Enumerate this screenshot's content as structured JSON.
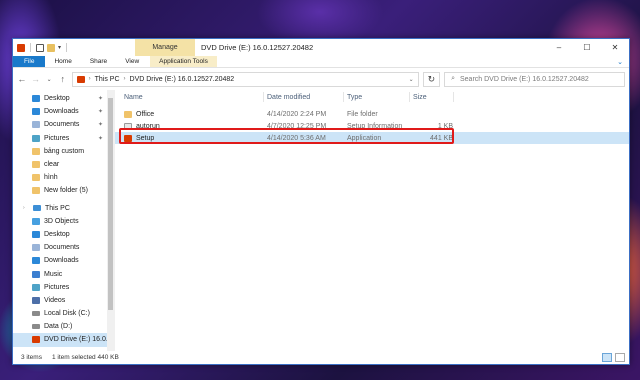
{
  "window": {
    "title": "DVD Drive (E:) 16.0.12527.20482",
    "manage_tab": "Manage",
    "controls": [
      "–",
      "☐",
      "✕"
    ]
  },
  "ribbon": {
    "tabs": [
      "File",
      "Home",
      "Share",
      "View",
      "Application Tools"
    ]
  },
  "address": {
    "crumbs": [
      "This PC",
      "DVD Drive (E:) 16.0.12527.20482"
    ],
    "search_placeholder": "Search DVD Drive (E:) 16.0.12527.20482"
  },
  "nav": {
    "quick_access": [
      {
        "label": "Desktop",
        "icon": "desktop-icon",
        "pinned": true
      },
      {
        "label": "Downloads",
        "icon": "downloads-icon",
        "pinned": true
      },
      {
        "label": "Documents",
        "icon": "documents-icon",
        "pinned": true
      },
      {
        "label": "Pictures",
        "icon": "pictures-icon",
        "pinned": true
      },
      {
        "label": "bảng custom",
        "icon": "folder-icon",
        "pinned": false
      },
      {
        "label": "clear",
        "icon": "folder-icon",
        "pinned": false
      },
      {
        "label": "hình",
        "icon": "folder-icon",
        "pinned": false
      },
      {
        "label": "New folder (5)",
        "icon": "folder-icon",
        "pinned": false
      }
    ],
    "this_pc_label": "This PC",
    "this_pc": [
      {
        "label": "3D Objects",
        "icon": "3d-objects-icon"
      },
      {
        "label": "Desktop",
        "icon": "desktop-icon"
      },
      {
        "label": "Documents",
        "icon": "documents-icon"
      },
      {
        "label": "Downloads",
        "icon": "downloads-icon"
      },
      {
        "label": "Music",
        "icon": "music-icon"
      },
      {
        "label": "Pictures",
        "icon": "pictures-icon"
      },
      {
        "label": "Videos",
        "icon": "videos-icon"
      },
      {
        "label": "Local Disk (C:)",
        "icon": "disk-icon"
      },
      {
        "label": "Data (D:)",
        "icon": "disk-icon"
      },
      {
        "label": "DVD Drive (E:) 16.0.1",
        "icon": "dvd-drive-icon"
      }
    ]
  },
  "columns": {
    "name": "Name",
    "date": "Date modified",
    "type": "Type",
    "size": "Size"
  },
  "files": [
    {
      "name": "Office",
      "date": "4/14/2020 2:24 PM",
      "type": "File folder",
      "size": "",
      "icon": "folder-icon"
    },
    {
      "name": "autorun",
      "date": "4/7/2020 12:25 PM",
      "type": "Setup Information",
      "size": "1 KB",
      "icon": "setup-info-icon"
    },
    {
      "name": "Setup",
      "date": "4/14/2020 5:36 AM",
      "type": "Application",
      "size": "441 KB",
      "icon": "office-setup-icon"
    }
  ],
  "status": {
    "item_count": "3 items",
    "selection": "1 item selected  440 KB"
  }
}
